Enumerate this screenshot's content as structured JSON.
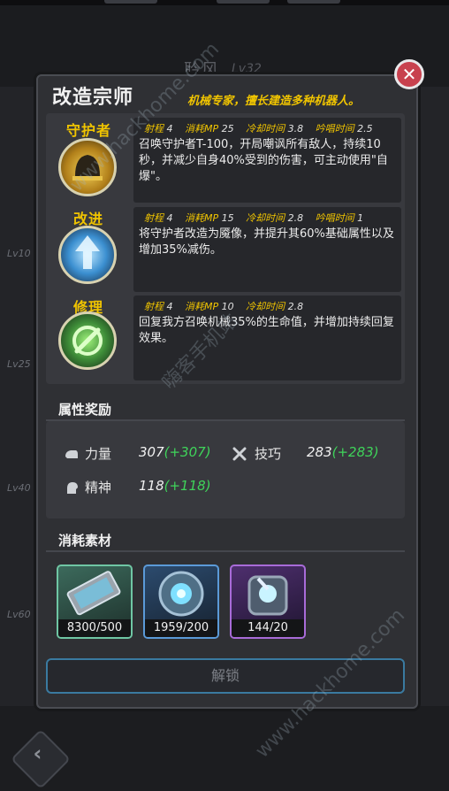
{
  "background": {
    "hero_name": "聆风",
    "hero_level": "Lv32",
    "level_marks": [
      "Lv10",
      "Lv25",
      "Lv40",
      "Lv60"
    ]
  },
  "dialog": {
    "title": "改造宗师",
    "subtitle": "机械专家，擅长建造多种机器人。",
    "close_icon": "close-icon"
  },
  "skills": [
    {
      "name": "守护者",
      "icon": "guardian-dome-icon",
      "stats": [
        {
          "label": "射程",
          "value": "4"
        },
        {
          "label": "消耗MP",
          "value": "25"
        },
        {
          "label": "冷却时间",
          "value": "3.8"
        },
        {
          "label": "吟唱时间",
          "value": "2.5"
        }
      ],
      "description": "召唤守护者T-100，开局嘲讽所有敌人，持续10秒，并减少自身40%受到的伤害，可主动使用\"自爆\"。"
    },
    {
      "name": "改进",
      "icon": "upgrade-arrow-icon",
      "stats": [
        {
          "label": "射程",
          "value": "4"
        },
        {
          "label": "消耗MP",
          "value": "15"
        },
        {
          "label": "冷却时间",
          "value": "2.8"
        },
        {
          "label": "吟唱时间",
          "value": "1"
        }
      ],
      "description": "将守护者改造为魇像，并提升其60%基础属性以及增加35%减伤。"
    },
    {
      "name": "修理",
      "icon": "repair-wrench-icon",
      "stats": [
        {
          "label": "射程",
          "value": "4"
        },
        {
          "label": "消耗MP",
          "value": "10"
        },
        {
          "label": "冷却时间",
          "value": "2.8"
        }
      ],
      "description": "回复我方召唤机械35%的生命值，并增加持续回复效果。"
    }
  ],
  "attributes": {
    "section_title": "属性奖励",
    "items": [
      {
        "name": "力量",
        "value": "307",
        "bonus": "(+307)",
        "icon": "strength-fist-icon"
      },
      {
        "name": "技巧",
        "value": "283",
        "bonus": "(+283)",
        "icon": "skill-tools-icon"
      },
      {
        "name": "精神",
        "value": "118",
        "bonus": "(+118)",
        "icon": "spirit-head-icon"
      }
    ]
  },
  "materials": {
    "section_title": "消耗素材",
    "items": [
      {
        "count": "8300/500",
        "icon": "circuit-board-icon",
        "border": "#6fc6a4"
      },
      {
        "count": "1959/200",
        "icon": "mech-core-icon",
        "border": "#5b9ad8"
      },
      {
        "count": "144/20",
        "icon": "energy-core-icon",
        "border": "#a86bd8"
      }
    ]
  },
  "unlock_button": "解锁",
  "watermarks": [
    "www.hackhome.com",
    "嗨客手机站"
  ]
}
